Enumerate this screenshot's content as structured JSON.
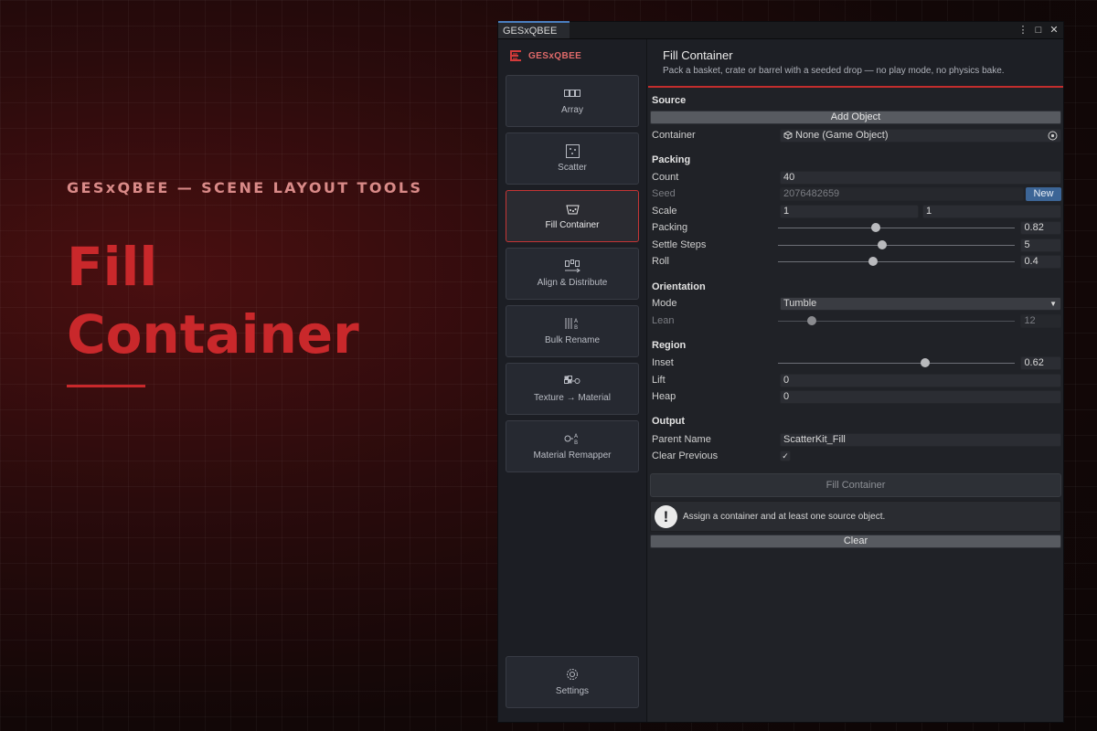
{
  "hero": {
    "kicker": "GESxQBEE — SCENE LAYOUT TOOLS",
    "title_line1": "Fill",
    "title_line2": "Container"
  },
  "window": {
    "tab": "GESxQBEE",
    "controls": [
      "⋮",
      "□",
      "✕"
    ]
  },
  "sidebar": {
    "brand": "GESxQBEE",
    "items": [
      {
        "label": "Array",
        "icon": "array-icon"
      },
      {
        "label": "Scatter",
        "icon": "scatter-icon"
      },
      {
        "label": "Fill Container",
        "icon": "basket-icon",
        "active": true
      },
      {
        "label": "Align & Distribute",
        "icon": "align-icon"
      },
      {
        "label": "Bulk Rename",
        "icon": "rename-icon"
      },
      {
        "label": "Texture → Material",
        "icon": "texture-icon"
      },
      {
        "label": "Material Remapper",
        "icon": "remap-icon"
      }
    ],
    "settings": {
      "label": "Settings",
      "icon": "gear-icon"
    }
  },
  "header": {
    "title": "Fill Container",
    "subtitle": "Pack a basket, crate or barrel with a seeded drop — no play mode, no physics bake."
  },
  "source": {
    "heading": "Source",
    "add_object": "Add Object",
    "container_label": "Container",
    "container_value": "None (Game Object)"
  },
  "packing": {
    "heading": "Packing",
    "count_label": "Count",
    "count_value": "40",
    "seed_label": "Seed",
    "seed_value": "2076482659",
    "new_label": "New",
    "scale_label": "Scale",
    "scale_min": "1",
    "scale_max": "1",
    "packing_label": "Packing",
    "packing_value": "0.82",
    "packing_fraction": 0.41,
    "settle_label": "Settle Steps",
    "settle_value": "5",
    "settle_fraction": 0.44,
    "roll_label": "Roll",
    "roll_value": "0.4",
    "roll_fraction": 0.4
  },
  "orientation": {
    "heading": "Orientation",
    "mode_label": "Mode",
    "mode_value": "Tumble",
    "lean_label": "Lean",
    "lean_value": "12",
    "lean_fraction": 0.14
  },
  "region": {
    "heading": "Region",
    "inset_label": "Inset",
    "inset_value": "0.62",
    "inset_fraction": 0.62,
    "lift_label": "Lift",
    "lift_value": "0",
    "heap_label": "Heap",
    "heap_value": "0"
  },
  "output": {
    "heading": "Output",
    "parent_label": "Parent Name",
    "parent_value": "ScatterKit_Fill",
    "clear_prev_label": "Clear Previous",
    "clear_prev_checked": true
  },
  "actions": {
    "fill": "Fill Container",
    "help": "Assign a container and at least one source object.",
    "clear": "Clear"
  },
  "colors": {
    "accent": "#c9282b",
    "new_button": "#3c6596"
  }
}
